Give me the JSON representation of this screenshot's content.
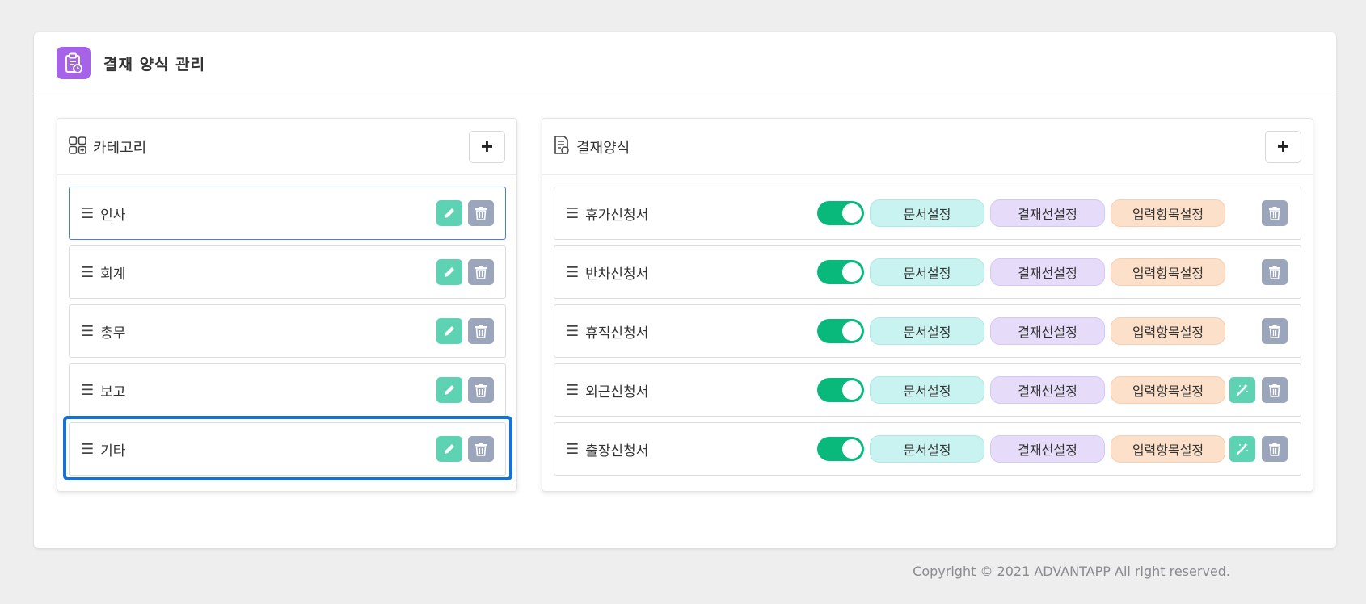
{
  "header": {
    "title": "결재 양식 관리",
    "icon": "clipboard-icon",
    "accent": "#a763e8"
  },
  "categories": {
    "title": "카테고리",
    "icon": "grid-icon",
    "add_label": "+",
    "items": [
      {
        "label": "인사",
        "active": true
      },
      {
        "label": "회계"
      },
      {
        "label": "총무"
      },
      {
        "label": "보고"
      },
      {
        "label": "기타",
        "highlighted": true
      }
    ]
  },
  "forms": {
    "title": "결재양식",
    "icon": "document-icon",
    "add_label": "+",
    "buttons": {
      "doc": "문서설정",
      "approval": "결재선설정",
      "input": "입력항목설정"
    },
    "items": [
      {
        "label": "휴가신청서",
        "enabled": true,
        "magic": false
      },
      {
        "label": "반차신청서",
        "enabled": true,
        "magic": false
      },
      {
        "label": "휴직신청서",
        "enabled": true,
        "magic": false
      },
      {
        "label": "외근신청서",
        "enabled": true,
        "magic": true
      },
      {
        "label": "출장신청서",
        "enabled": true,
        "magic": true
      }
    ]
  },
  "footer": {
    "copyright": "Copyright © 2021 ADVANTAPP All right reserved."
  },
  "colors": {
    "toggle_on": "#08b97b",
    "edit": "#5dd3b4",
    "delete": "#9ba6bd",
    "selection": "#1672d6"
  }
}
